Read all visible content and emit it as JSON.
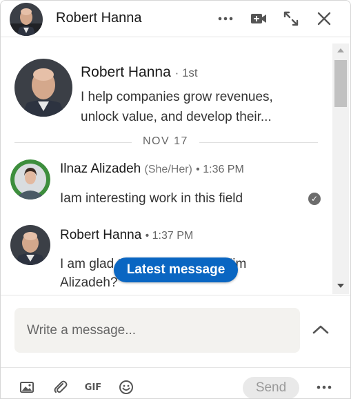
{
  "header": {
    "name": "Robert Hanna",
    "icons": [
      "more-horizontal-icon",
      "video-call-icon",
      "expand-icon",
      "close-icon"
    ]
  },
  "profile": {
    "name": "Robert Hanna",
    "degree": "· 1st",
    "headline_line1": "I help companies grow revenues,",
    "headline_line2": "unlock value, and develop their..."
  },
  "date_divider": "NOV 17",
  "messages": [
    {
      "sender": "Ilnaz Alizadeh",
      "pronouns": "(She/Her)",
      "time": "• 1:36 PM",
      "text": "Iam interesting work in this field",
      "seen": true
    },
    {
      "sender": "Robert Hanna",
      "time": "• 1:37 PM",
      "text_line1": "I am glad to hear this. What Kim",
      "text_line2": "Alizadeh?"
    }
  ],
  "latest_message_label": "Latest message",
  "composer": {
    "placeholder": "Write a message...",
    "send_label": "Send",
    "gif_label": "GIF"
  },
  "colors": {
    "accent": "#0a66c2",
    "composer_bg": "#f3f2ef",
    "open_to_work_green": "#3d8e3d"
  }
}
